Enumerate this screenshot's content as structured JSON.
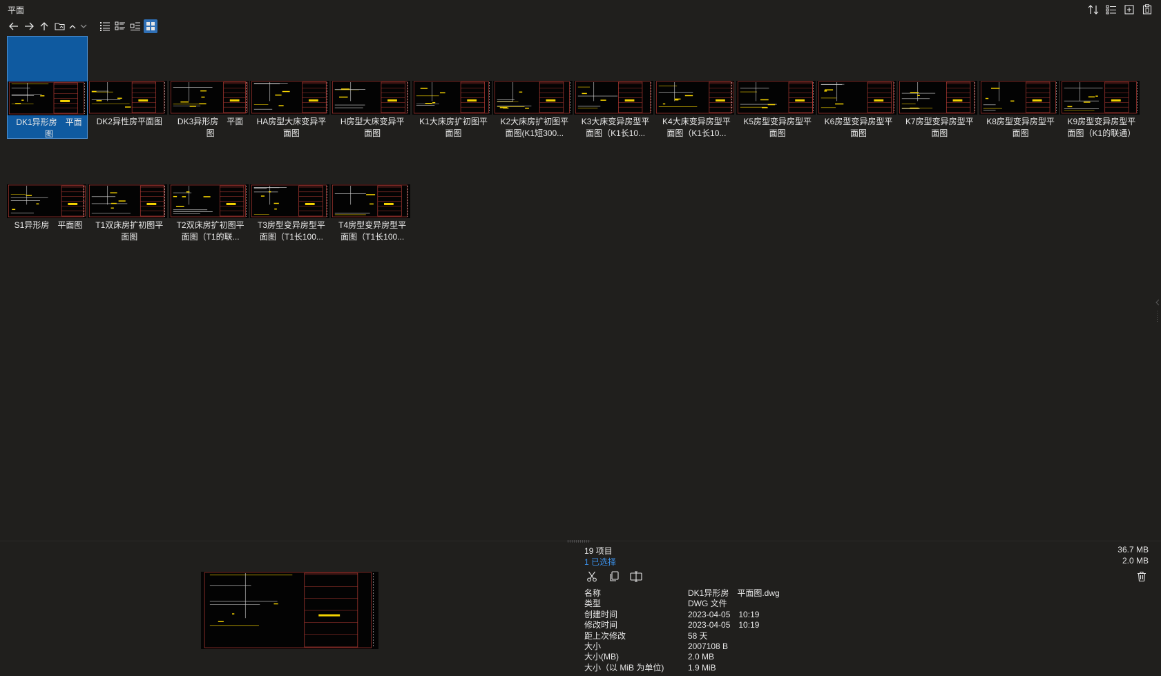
{
  "window": {
    "title": "平面"
  },
  "toolbar": {
    "icons": [
      "arrow-left-icon",
      "arrow-right-icon",
      "arrow-up-icon",
      "folder-icon",
      "chevron-up-icon",
      "chevron-down-icon",
      "list-view-icon",
      "details-view-icon",
      "tiles-view-icon",
      "grid-view-icon"
    ],
    "top_right_icons": [
      "sort-icon",
      "checklist-icon",
      "new-pane-icon",
      "clipboard-icon"
    ]
  },
  "files": [
    {
      "name": "DK1异形房　平面图",
      "selected": true
    },
    {
      "name": "DK2异性房平面图"
    },
    {
      "name": "DK3异形房　平面图"
    },
    {
      "name": "HA房型大床变异平面图"
    },
    {
      "name": "H房型大床变异平面图"
    },
    {
      "name": "K1大床房扩初图平面图"
    },
    {
      "name": "K2大床房扩初图平面图(K1短300..."
    },
    {
      "name": "K3大床变异房型平面图（K1长10..."
    },
    {
      "name": "K4大床变异房型平面图（K1长10..."
    },
    {
      "name": "K5房型变异房型平面图"
    },
    {
      "name": "K6房型变异房型平面图"
    },
    {
      "name": "K7房型变异房型平面图"
    },
    {
      "name": "K8房型变异房型平面图"
    },
    {
      "name": "K9房型变异房型平面图（K1的联通）"
    },
    {
      "name": "S1异形房　平面图"
    },
    {
      "name": "T1双床房扩初图平面图"
    },
    {
      "name": "T2双床房扩初图平面图（T1的联..."
    },
    {
      "name": "T3房型变异房型平面图（T1长100..."
    },
    {
      "name": "T4房型变异房型平面图（T1长100..."
    }
  ],
  "status": {
    "item_count": "19 项目",
    "selected_count": "1 已选择",
    "total_size": "36.7 MB",
    "selected_size": "2.0 MB"
  },
  "properties": [
    {
      "key": "名称",
      "value": "DK1异形房　平面图.dwg"
    },
    {
      "key": "类型",
      "value": "DWG 文件"
    },
    {
      "key": "创建时间",
      "value": "2023-04-05　10:19"
    },
    {
      "key": "修改时间",
      "value": "2023-04-05　10:19"
    },
    {
      "key": "距上次修改",
      "value": "58 天"
    },
    {
      "key": "大小",
      "value": "2007108 B"
    },
    {
      "key": "大小(MB)",
      "value": "2.0 MB"
    },
    {
      "key": "大小（以 MiB 为单位)",
      "value": "1.9 MiB"
    }
  ],
  "colors": {
    "accent": "#0f5aa0",
    "link": "#3a8ee6",
    "cad_red": "#c0392b",
    "cad_yellow": "#f5d300"
  }
}
